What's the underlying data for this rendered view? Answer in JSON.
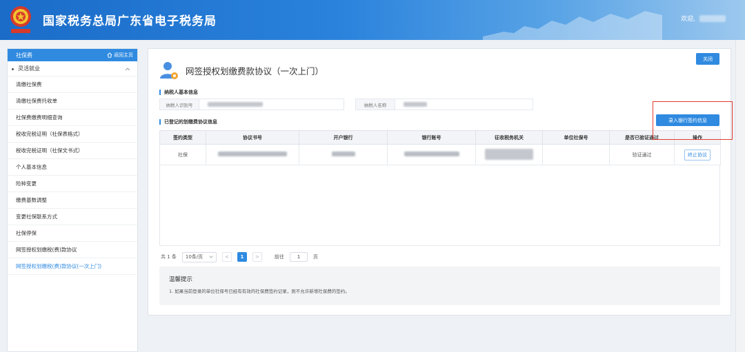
{
  "header": {
    "title": "国家税务总局广东省电子税务局",
    "welcome": "欢迎,"
  },
  "sidebar": {
    "head_label": "社保费",
    "home_link": "返回主页",
    "group_label": "灵活就业",
    "items": [
      {
        "label": "清缴社保费"
      },
      {
        "label": "清缴社保费托收单"
      },
      {
        "label": "社保费缴费明细查询"
      },
      {
        "label": "税收完税证明（社保表格式）"
      },
      {
        "label": "税收完税证明（社保文书式）"
      },
      {
        "label": "个人基本信息"
      },
      {
        "label": "险种变更"
      },
      {
        "label": "缴费基数调整"
      },
      {
        "label": "变更社保联系方式"
      },
      {
        "label": "社保停保"
      },
      {
        "label": "网签授权划缴税(费)款协议"
      },
      {
        "label": "网签授权划缴税(费)款协议(一次上门)"
      }
    ],
    "active_index": 11
  },
  "main": {
    "close_label": "关闭",
    "page_title": "网签授权划缴费款协议（一次上门）",
    "section1": "纳税人基本信息",
    "taxpayer_id_label": "纳税人识别号",
    "taxpayer_name_label": "纳税人名称",
    "section2": "已登记的划缴费协议信息",
    "add_button": "录入银行签约信息",
    "table": {
      "headers": [
        "签约类型",
        "协议书号",
        "开户银行",
        "银行账号",
        "征收税务机关",
        "单位社保号",
        "是否已验证通过",
        "操作"
      ],
      "rows": [
        {
          "type": "社保",
          "status": "验证通过",
          "action": "终止协议"
        }
      ]
    },
    "pager": {
      "total": "共 1 条",
      "page_size": "10条/页",
      "current": "1",
      "prev": "<",
      "next": ">",
      "goto_label": "前往",
      "goto_value": "1",
      "page_suffix": "页"
    },
    "tips": {
      "title": "温馨提示",
      "text": "1. 如果当前登录的单位社保号已经有有效的社保费签约记录，则不允许新增社保费的签约。"
    }
  },
  "colors": {
    "accent": "#2f8ae0",
    "highlight": "#e33b2e"
  }
}
